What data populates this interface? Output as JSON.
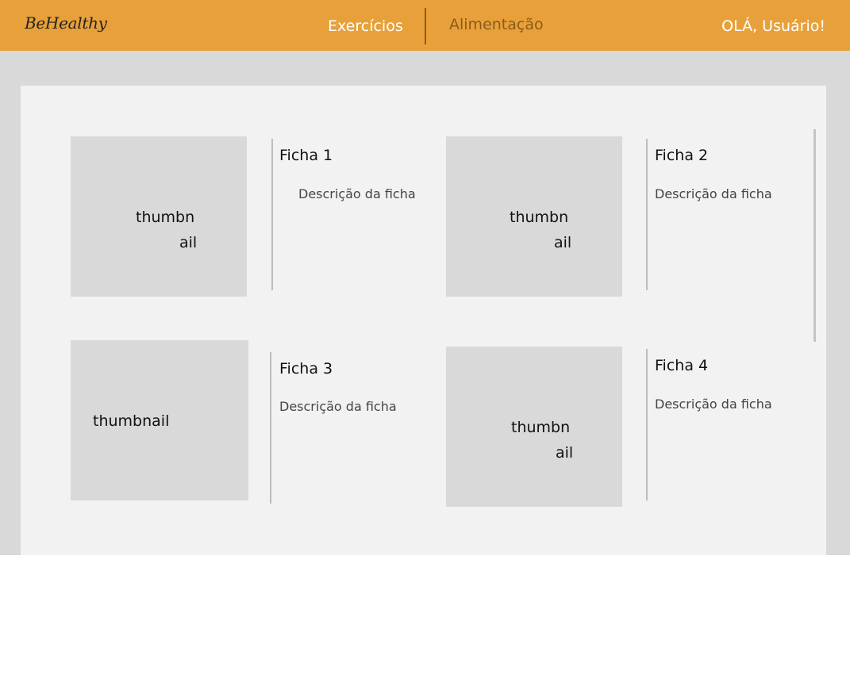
{
  "header": {
    "logo": "BeHealthy",
    "nav": [
      {
        "label": "Exercícios"
      },
      {
        "label": "Alimentação"
      }
    ],
    "greeting": "OLÁ, Usuário!"
  },
  "cards": [
    {
      "title": "Ficha 1",
      "description": "Descrição da ficha",
      "thumbnail_lines": [
        "thumbn",
        "ail"
      ]
    },
    {
      "title": "Ficha 2",
      "description": "Descrição da ficha",
      "thumbnail_lines": [
        "thumbn",
        "ail"
      ]
    },
    {
      "title": "Ficha 3",
      "description": "Descrição da ficha",
      "thumbnail_lines": [
        "thumbnail"
      ]
    },
    {
      "title": "Ficha 4",
      "description": "Descrição da ficha",
      "thumbnail_lines": [
        "thumbn",
        "ail"
      ]
    }
  ],
  "colors": {
    "header_bg": "#e8a13a",
    "active_nav": "#8a5a1c",
    "panel_bg": "#f2f2f2",
    "thumbnail_bg": "#d9d9d9"
  }
}
